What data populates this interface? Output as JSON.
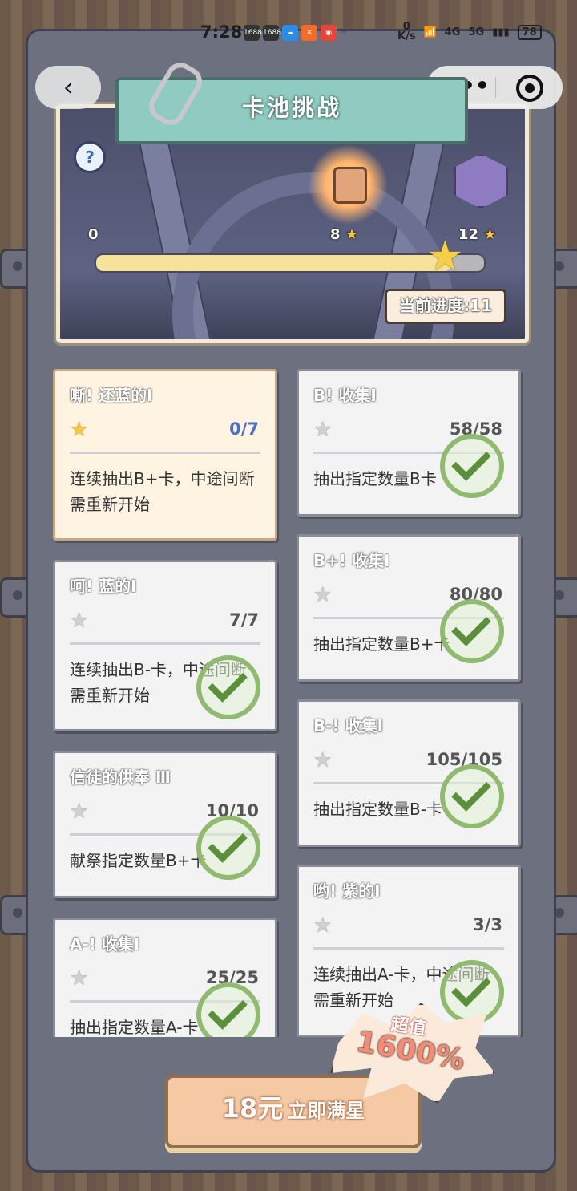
{
  "status_bar": {
    "time": "7:28",
    "app_icons": [
      "1688",
      "1688",
      "weather",
      "app",
      "app"
    ],
    "overflow": "···",
    "net_speed_value": "0",
    "net_speed_unit": "K/s",
    "wifi_label": "4G",
    "signal_label": "5G",
    "battery": "78"
  },
  "header": {
    "back_icon": "chevron-left-icon",
    "more_label": "•••",
    "title": "卡池挑战"
  },
  "progress": {
    "start_label": "0",
    "mid_label": "8",
    "end_label": "12",
    "current_text": "当前进度:11",
    "current_value": 11,
    "max_value": 12
  },
  "tasks_left": [
    {
      "title": "嘶! 还蓝的Ⅰ",
      "progress": "0/7",
      "desc": "连续抽出B+卡，中途间断需重新开始",
      "done": false,
      "active": true
    },
    {
      "title": "呵! 蓝的Ⅰ",
      "progress": "7/7",
      "desc": "连续抽出B-卡，中途间断需重新开始",
      "done": true,
      "active": false
    },
    {
      "title": "信徒的供奉 Ⅲ",
      "progress": "10/10",
      "desc": "献祭指定数量B+卡",
      "done": true,
      "active": false
    },
    {
      "title": "A-! 收集Ⅰ",
      "progress": "25/25",
      "desc": "抽出指定数量A-卡",
      "done": true,
      "active": false
    }
  ],
  "tasks_right": [
    {
      "title": "B! 收集Ⅰ",
      "progress": "58/58",
      "desc": "抽出指定数量B卡",
      "done": true,
      "active": false
    },
    {
      "title": "B+! 收集Ⅰ",
      "progress": "80/80",
      "desc": "抽出指定数量B+卡",
      "done": true,
      "active": false
    },
    {
      "title": "B-! 收集Ⅰ",
      "progress": "105/105",
      "desc": "抽出指定数量B-卡",
      "done": true,
      "active": false
    },
    {
      "title": "哟! 紫的Ⅰ",
      "progress": "3/3",
      "desc": "连续抽出A-卡，中途间断需重新开始",
      "done": true,
      "active": false
    }
  ],
  "promo": {
    "price": "18元",
    "action": "立即满星",
    "badge_top": "超值",
    "badge_main": "1600%"
  }
}
